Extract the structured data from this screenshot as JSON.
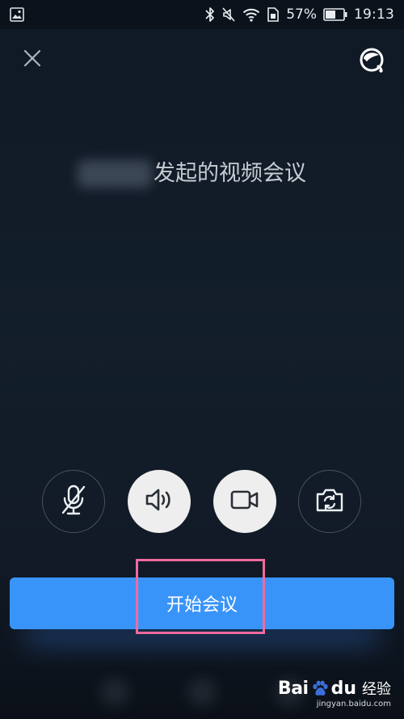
{
  "status_bar": {
    "battery_text": "57%",
    "battery_level": 0.57,
    "time": "19:13",
    "icons": [
      "gallery-icon",
      "bluetooth-icon",
      "mute-icon",
      "wifi-icon",
      "sim-icon",
      "battery-icon"
    ]
  },
  "top_bar": {
    "close_icon": "close-icon",
    "service_icon": "customer-service-icon"
  },
  "meeting": {
    "caption": "发起的视频会议"
  },
  "controls": [
    {
      "name": "mic-muted",
      "icon": "mic-off-icon",
      "active": false
    },
    {
      "name": "speaker",
      "icon": "speaker-icon",
      "active": true
    },
    {
      "name": "camera",
      "icon": "video-camera-icon",
      "active": true
    },
    {
      "name": "switch-camera",
      "icon": "camera-switch-icon",
      "active": false
    }
  ],
  "start_button": {
    "label": "开始会议"
  },
  "colors": {
    "accent": "#3994f9",
    "highlight": "#f06a9e",
    "background": "#111b27"
  },
  "watermark": {
    "brand_bai": "Bai",
    "brand_du": "du",
    "brand_cn": "经验",
    "url": "jingyan.baidu.com"
  }
}
